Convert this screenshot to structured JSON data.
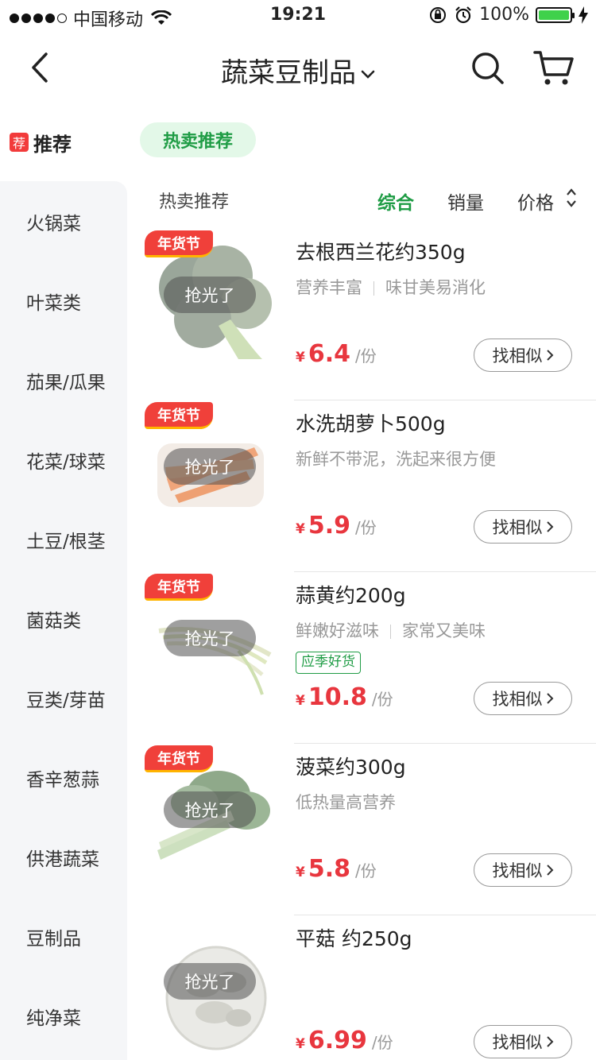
{
  "status_bar": {
    "carrier": "中国移动",
    "time": "19:21",
    "battery": "100%"
  },
  "nav": {
    "title": "蔬菜豆制品"
  },
  "sidebar": {
    "active": {
      "tag": "荐",
      "label": "推荐"
    },
    "items": [
      "火锅菜",
      "叶菜类",
      "茄果/瓜果",
      "花菜/球菜",
      "土豆/根茎",
      "菌菇类",
      "豆类/芽苗",
      "香辛葱蒜",
      "供港蔬菜",
      "豆制品",
      "纯净菜"
    ]
  },
  "filter_chip": "热卖推荐",
  "sort_bar": {
    "title": "热卖推荐",
    "options": [
      "综合",
      "销量",
      "价格"
    ],
    "active_option": "综合"
  },
  "products": [
    {
      "name": "去根西兰花约350g",
      "desc": [
        "营养丰富",
        "味甘美易消化"
      ],
      "tag": "",
      "badge": "年货节",
      "soldout": "抢光了",
      "currency": "¥",
      "price": "6.4",
      "unit": "/份",
      "similar": "找相似",
      "image": "broccoli-image"
    },
    {
      "name": "水洗胡萝卜500g",
      "desc": [
        "新鲜不带泥，洗起来很方便"
      ],
      "tag": "",
      "badge": "年货节",
      "soldout": "抢光了",
      "currency": "¥",
      "price": "5.9",
      "unit": "/份",
      "similar": "找相似",
      "image": "carrot-image"
    },
    {
      "name": "蒜黄约200g",
      "desc": [
        "鲜嫩好滋味",
        "家常又美味"
      ],
      "tag": "应季好货",
      "badge": "年货节",
      "soldout": "抢光了",
      "currency": "¥",
      "price": "10.8",
      "unit": "/份",
      "similar": "找相似",
      "image": "garlic-chives-image"
    },
    {
      "name": "菠菜约300g",
      "desc": [
        "低热量高营养"
      ],
      "tag": "",
      "badge": "年货节",
      "soldout": "抢光了",
      "currency": "¥",
      "price": "5.8",
      "unit": "/份",
      "similar": "找相似",
      "image": "spinach-image"
    },
    {
      "name": "平菇 约250g",
      "desc": [],
      "tag": "",
      "badge": "",
      "soldout": "抢光了",
      "currency": "¥",
      "price": "6.99",
      "unit": "/份",
      "similar": "找相似",
      "image": "oyster-mushroom-image"
    }
  ],
  "colors": {
    "accent_green": "#1f9c45",
    "price_red": "#e8363e",
    "badge_red": "#f0403a"
  }
}
